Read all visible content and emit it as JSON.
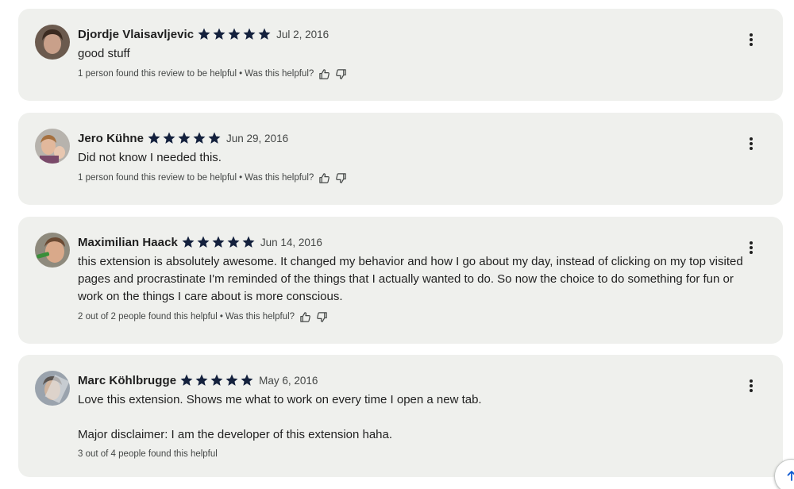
{
  "reviews": [
    {
      "author": "Djordje Vlaisavljevic",
      "rating": 5,
      "date": "Jul 2, 2016",
      "text": [
        "good stuff"
      ],
      "helpful_text": "1 person found this review to be helpful",
      "separator": "•",
      "was_helpful": "Was this helpful?",
      "avatar_colors": {
        "bg": "#6b5a4e",
        "face": "#c9a08a",
        "hair": "#3b2a20"
      }
    },
    {
      "author": "Jero Kühne",
      "rating": 5,
      "date": "Jun 29, 2016",
      "text": [
        "Did not know I needed this."
      ],
      "helpful_text": "1 person found this review to be helpful",
      "separator": "•",
      "was_helpful": "Was this helpful?",
      "avatar_colors": {
        "bg": "#b7b3ad",
        "face": "#e2b89c",
        "hair": "#a5703f"
      }
    },
    {
      "author": "Maximilian Haack",
      "rating": 5,
      "date": "Jun 14, 2016",
      "text": [
        "this extension is absolutely awesome. It changed my behavior and how I go about my day, instead of clicking on my top visited pages and procrastinate I'm reminded of the things that I actually wanted to do. So now the choice to do something for fun or work on the things I care about is more conscious."
      ],
      "helpful_text": "2 out of 2 people found this helpful",
      "separator": "•",
      "was_helpful": "Was this helpful?",
      "avatar_colors": {
        "bg": "#8e8a7d",
        "face": "#d9a98a",
        "hair": "#6b4a33"
      }
    },
    {
      "author": "Marc Köhlbrugge",
      "rating": 5,
      "date": "May 6, 2016",
      "text": [
        "Love this extension. Shows me what to work on every time I open a new tab.",
        "Major disclaimer: I am the developer of this extension haha."
      ],
      "helpful_text": "3 out of 4 people found this helpful",
      "separator": "",
      "was_helpful": "",
      "avatar_colors": {
        "bg": "#9aa3ad",
        "face": "#d0b49e",
        "hair": "#5a5450"
      }
    }
  ],
  "icons": {
    "star": "star-icon",
    "thumbs_up": "thumbs-up-icon",
    "thumbs_down": "thumbs-down-icon",
    "more": "more-vert-icon",
    "scroll_top": "arrow-up-icon"
  },
  "colors": {
    "card_bg": "#eff0ed",
    "star": "#14213d",
    "text": "#1f1f1f",
    "muted": "#444746"
  }
}
